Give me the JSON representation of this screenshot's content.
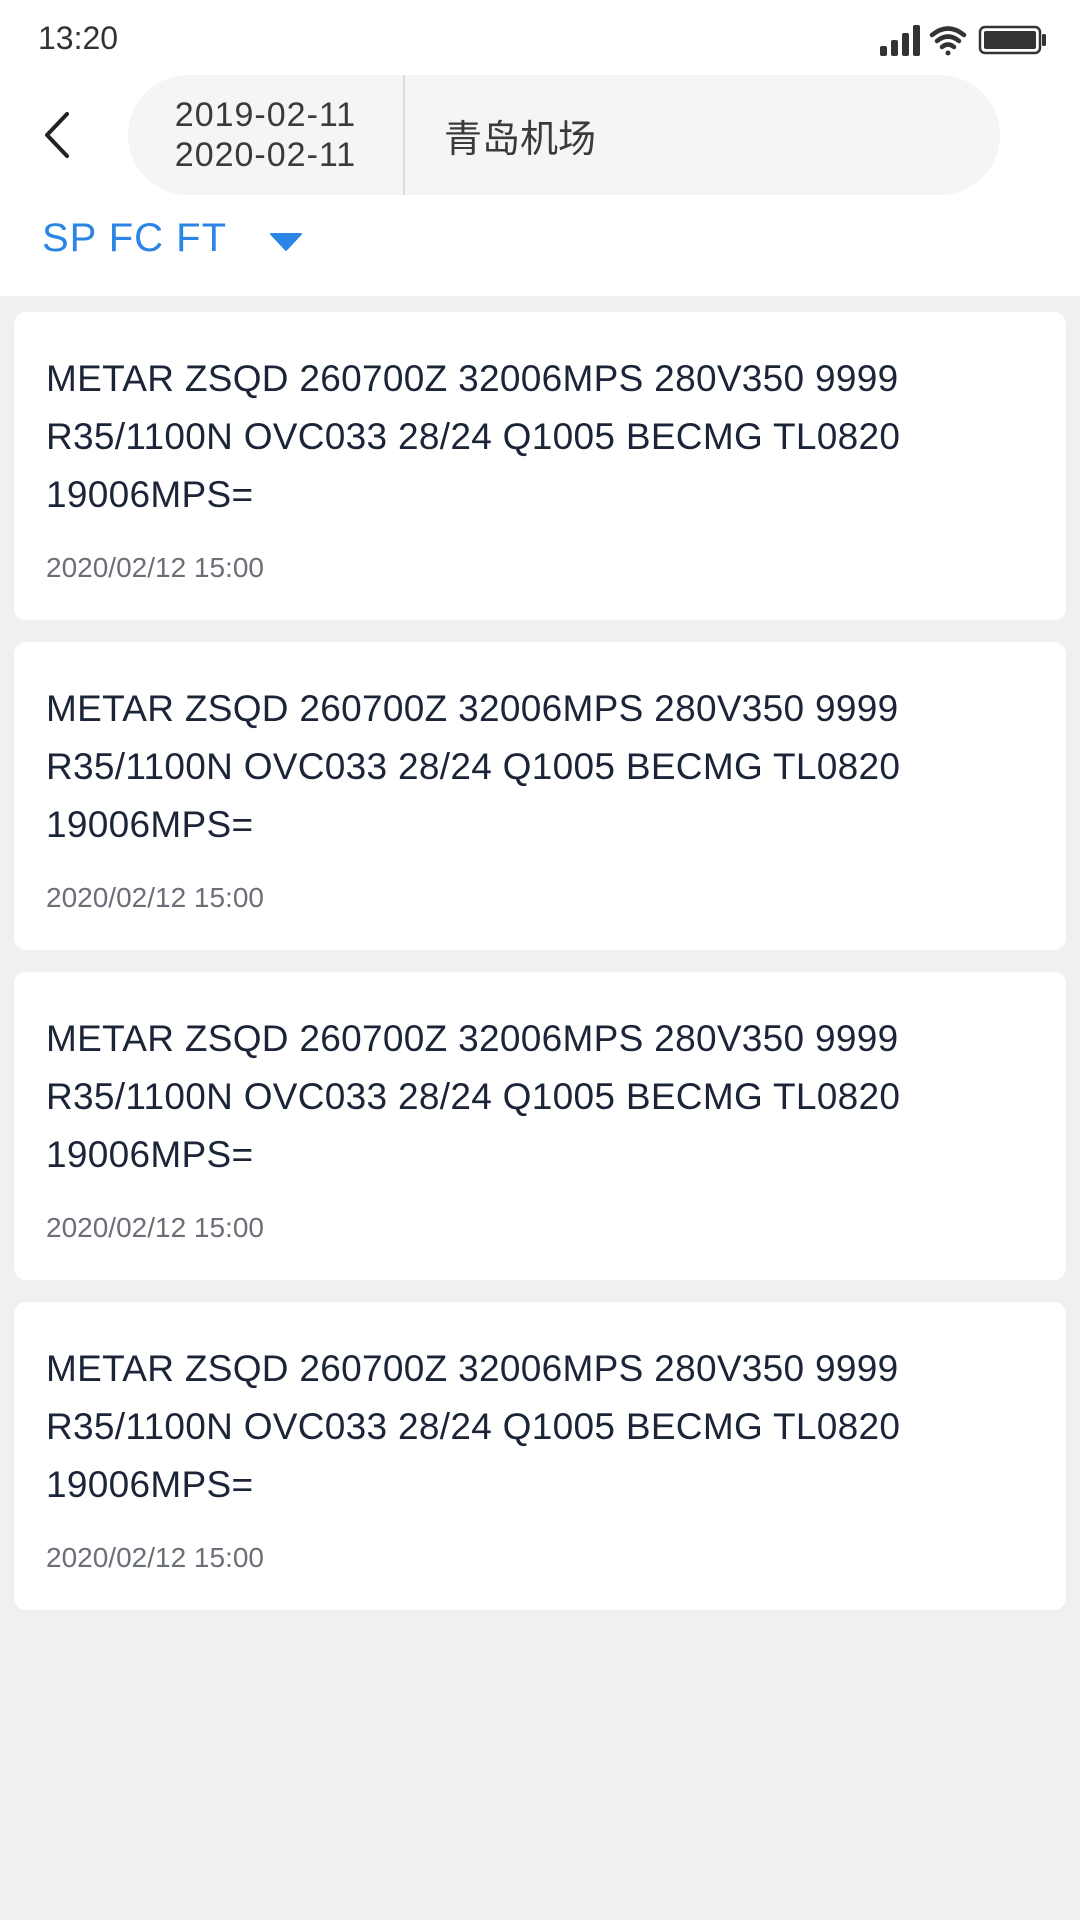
{
  "status_bar": {
    "time": "13:20",
    "icons": [
      "signal-icon",
      "wifi-icon",
      "battery-icon"
    ]
  },
  "header": {
    "back_icon": "chevron-left-icon",
    "date_start": "2019-02-11",
    "date_end": "2020-02-11",
    "airport": "青岛机场"
  },
  "filter": {
    "label": "SP FC FT",
    "icon": "caret-down-icon",
    "accent_color": "#2b85e4"
  },
  "reports": [
    {
      "line1": "METAR ZSQD 260700Z 32006MPS 280V350 9999",
      "line2": "R35/1100N OVC033 28/24 Q1005 BECMG TL0820",
      "line3": "19006MPS=",
      "time": "2020/02/12 15:00"
    },
    {
      "line1": "METAR ZSQD 260700Z 32006MPS 280V350 9999",
      "line2": "R35/1100N OVC033 28/24 Q1005 BECMG TL0820",
      "line3": "19006MPS=",
      "time": "2020/02/12 15:00"
    },
    {
      "line1": "METAR ZSQD 260700Z 32006MPS 280V350 9999",
      "line2": "R35/1100N OVC033 28/24 Q1005 BECMG TL0820",
      "line3": "19006MPS=",
      "time": "2020/02/12 15:00"
    },
    {
      "line1": "METAR ZSQD 260700Z 32006MPS 280V350 9999",
      "line2": "R35/1100N OVC033 28/24 Q1005 BECMG TL0820",
      "line3": "19006MPS=",
      "time": "2020/02/12 15:00"
    }
  ]
}
